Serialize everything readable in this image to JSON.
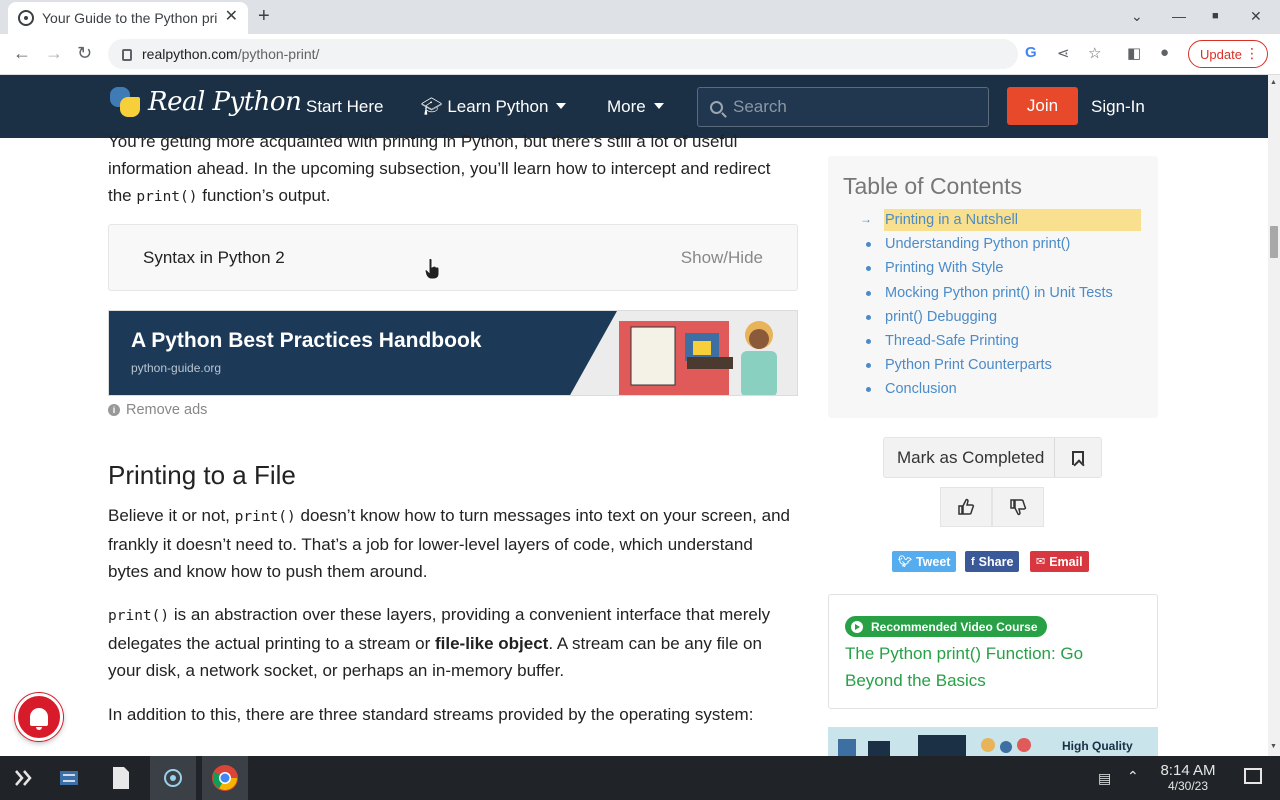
{
  "browser": {
    "tab_title": "Your Guide to the Python print() Function",
    "url_host": "realpython.com",
    "url_path": "/python-print/",
    "update_label": "Update"
  },
  "site": {
    "logo_text": "Real Python",
    "nav": {
      "start_here": "Start Here",
      "learn_python": "Learn Python",
      "more": "More"
    },
    "search_placeholder": "Search",
    "join": "Join",
    "signin": "Sign-In"
  },
  "article": {
    "intro_line1": "You’re getting more acquainted with printing in Python, but there’s still a lot of useful",
    "intro_line2": "information ahead. In the upcoming subsection, you’ll learn how to intercept and redirect",
    "intro_the": "the",
    "intro_code": "print()",
    "intro_tail": "function’s output.",
    "collapse_title": "Syntax in Python 2",
    "collapse_toggle": "Show/Hide",
    "ad_title": "A Python Best Practices Handbook",
    "ad_url": "python-guide.org",
    "remove_ads": "Remove ads",
    "section_heading": "Printing to a File",
    "p1_a": "Believe it or not,",
    "p1_code": "print()",
    "p1_b": "doesn’t know how to turn messages into text on your screen, and frankly it doesn’t need to. That’s a job for lower-level layers of code, which understand bytes and know how to push them around.",
    "p2_code": "print()",
    "p2_a": "is an abstraction over these layers, providing a convenient interface that merely delegates the actual printing to a stream or",
    "p2_bold": "file-like object",
    "p2_b": ". A stream can be any file on your disk, a network socket, or perhaps an in-memory buffer.",
    "p3": "In addition to this, there are three standard streams provided by the operating system:"
  },
  "sidebar": {
    "toc_title": "Table of Contents",
    "toc_items": [
      "Printing in a Nutshell",
      "Understanding Python print()",
      "Printing With Style",
      "Mocking Python print() in Unit Tests",
      "print() Debugging",
      "Thread-Safe Printing",
      "Python Print Counterparts",
      "Conclusion"
    ],
    "mark_completed": "Mark as Completed",
    "share": {
      "tweet": "Tweet",
      "share": "Share",
      "email": "Email"
    },
    "rec_badge": "Recommended Video Course",
    "rec_title": "The Python print() Function: Go Beyond the Basics",
    "ad2_text": "High Quality"
  },
  "taskbar": {
    "time": "8:14 AM",
    "date": "4/30/23"
  },
  "colors": {
    "header_bg": "#1b2f45",
    "join": "#e8492a",
    "toc_link": "#4b8bc8",
    "toc_highlight": "#f8e08e",
    "rec_green": "#27a046",
    "tweet": "#55acee",
    "share_fb": "#3b5998",
    "email": "#d8373f"
  }
}
